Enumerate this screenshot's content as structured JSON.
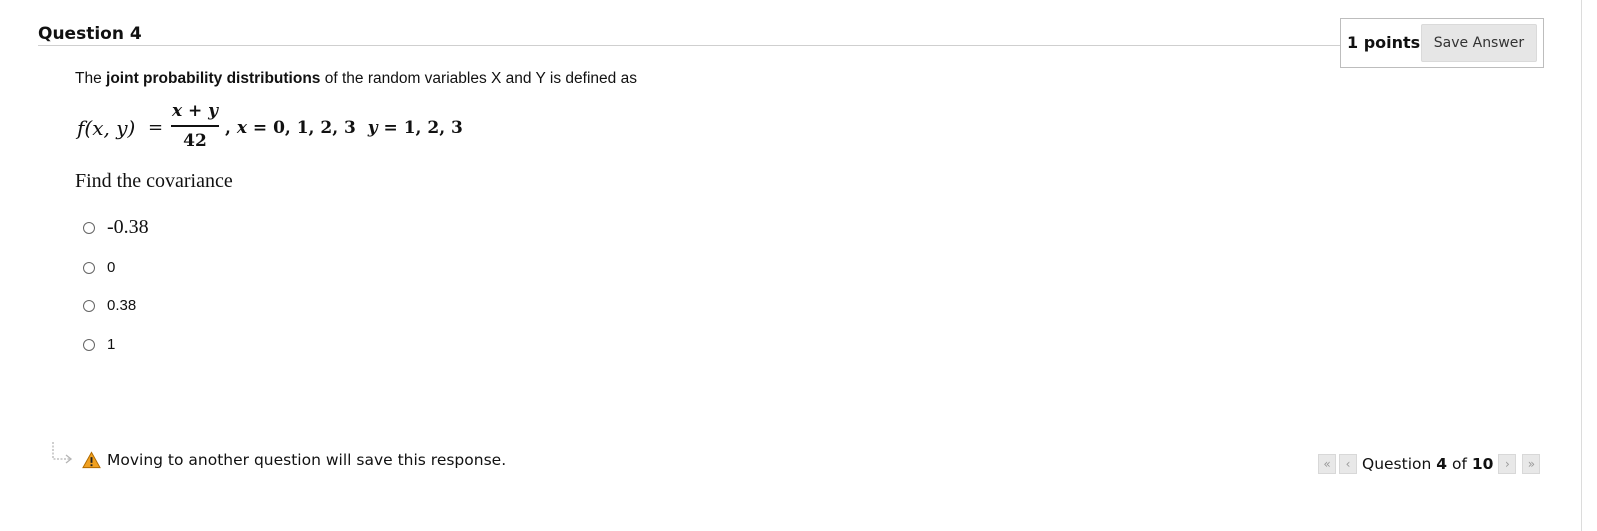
{
  "question": {
    "title": "Question 4",
    "points_label": "1 points",
    "save_button_label": "Save Answer",
    "prompt_before": "The ",
    "prompt_bold": "joint probability distributions",
    "prompt_after": " of the random variables X and Y is defined as",
    "formula": {
      "lhs": "f(x, y)",
      "equals": "=",
      "numerator": "x + y",
      "denominator": "42",
      "condition_x_var": "x",
      "condition_x": " = 0, 1, 2, 3  ",
      "condition_y_var": "y",
      "condition_y": " = 1, 2, 3",
      "separator": ","
    },
    "find_text": "Find the covariance",
    "options": [
      {
        "label": "-0.38"
      },
      {
        "label": "0"
      },
      {
        "label": "0.38"
      },
      {
        "label": "1"
      }
    ]
  },
  "footer": {
    "warning_text": "Moving to another question will save this response.",
    "nav_prefix": "Question ",
    "nav_current": "4",
    "nav_of": " of ",
    "nav_total": "10",
    "nav_first_glyph": "«",
    "nav_prev_glyph": "‹",
    "nav_next_glyph": "›",
    "nav_last_glyph": "»"
  },
  "colors": {
    "warning_icon": "#f0a020",
    "button_bg": "#e6e6e6"
  }
}
